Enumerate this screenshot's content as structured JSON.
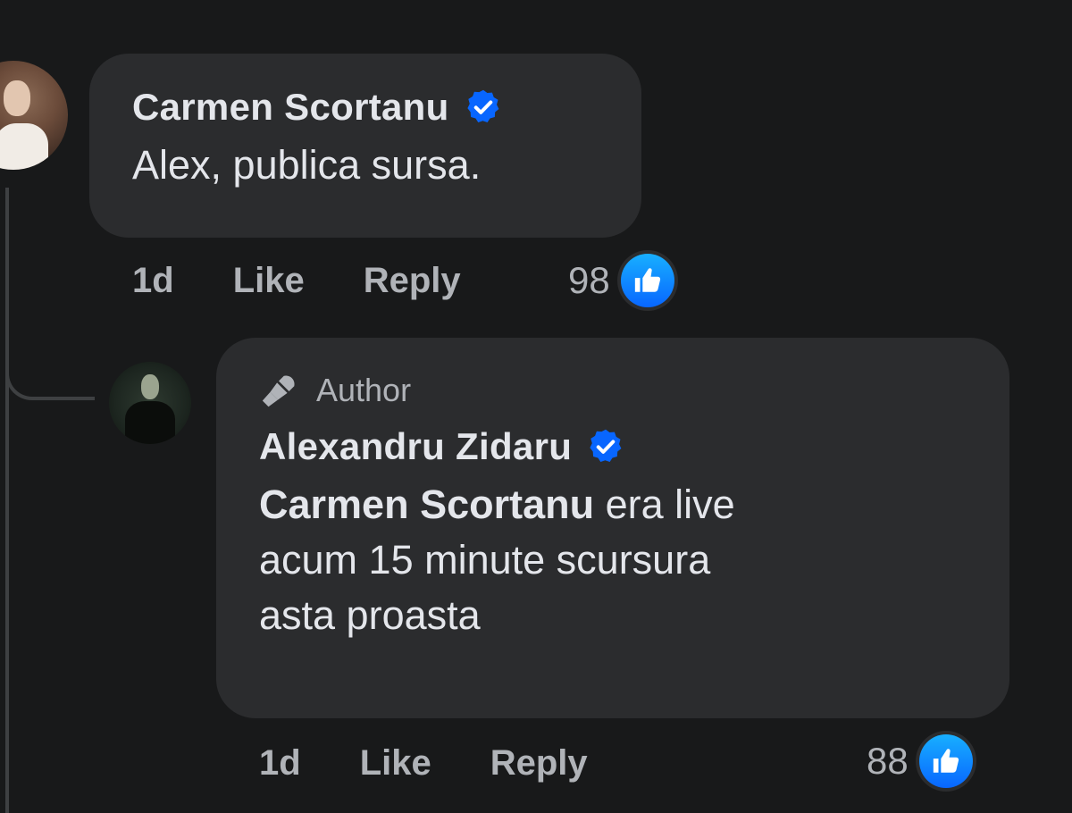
{
  "comments": [
    {
      "author": "Carmen Scortanu",
      "verified": true,
      "text": "Alex, publica sursa.",
      "time": "1d",
      "like_label": "Like",
      "reply_label": "Reply",
      "reaction_count": "98"
    },
    {
      "badge": "Author",
      "author": "Alexandru Zidaru",
      "verified": true,
      "mention": "Carmen Scortanu",
      "text_line1": " era live",
      "text_line2": "acum 15 minute scursura",
      "text_line3": "asta proasta",
      "time": "1d",
      "like_label": "Like",
      "reply_label": "Reply",
      "reaction_count": "88"
    }
  ],
  "colors": {
    "background": "#18191a",
    "bubble": "#2b2c2e",
    "primary_text": "#e4e6eb",
    "secondary_text": "#b0b3b8",
    "verified_blue": "#0866ff",
    "thread_line": "#3e4042"
  },
  "icons": [
    "verified-badge-icon",
    "microphone-icon",
    "like-thumb-icon"
  ]
}
